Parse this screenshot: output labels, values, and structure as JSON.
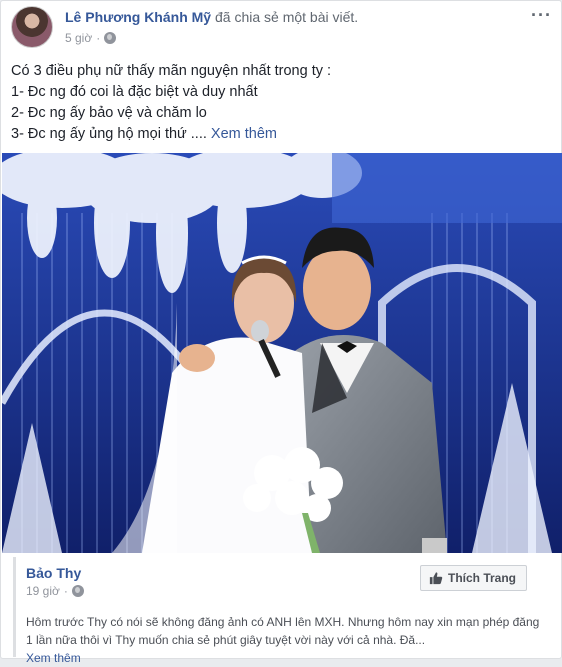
{
  "post": {
    "author": "Lê Phương Khánh Mỹ",
    "action": "đã chia sẻ một bài viết.",
    "time": "5 giờ",
    "lines": [
      "Có 3 điều phụ nữ thấy mãn nguyện nhất trong ty :",
      "1- Đc ng đó coi là đặc biệt và duy nhất",
      "2- Đc ng ấy bảo vệ và chăm lo",
      "3- Đc ng ấy ủng hộ mọi thứ ...."
    ],
    "see_more": "Xem thêm"
  },
  "shared": {
    "page_name": "Bảo Thy",
    "time": "19 giờ",
    "like_label": "Thích Trang",
    "text": "Hôm trước Thy có nói sẽ không đăng ảnh có ANH lên MXH. Nhưng hôm nay xin mạn phép đăng 1 lần nữa thôi vì Thy muốn chia sẻ phút giây tuyệt vời này với cả nhà. Đă...",
    "see_more": "Xem thêm"
  },
  "icons": {
    "privacy": "globe-icon",
    "options": "more-options-icon",
    "like": "thumbs-up-icon"
  },
  "colors": {
    "link": "#365899",
    "muted": "#90949c",
    "stage_blue": "#1a2f8a"
  }
}
